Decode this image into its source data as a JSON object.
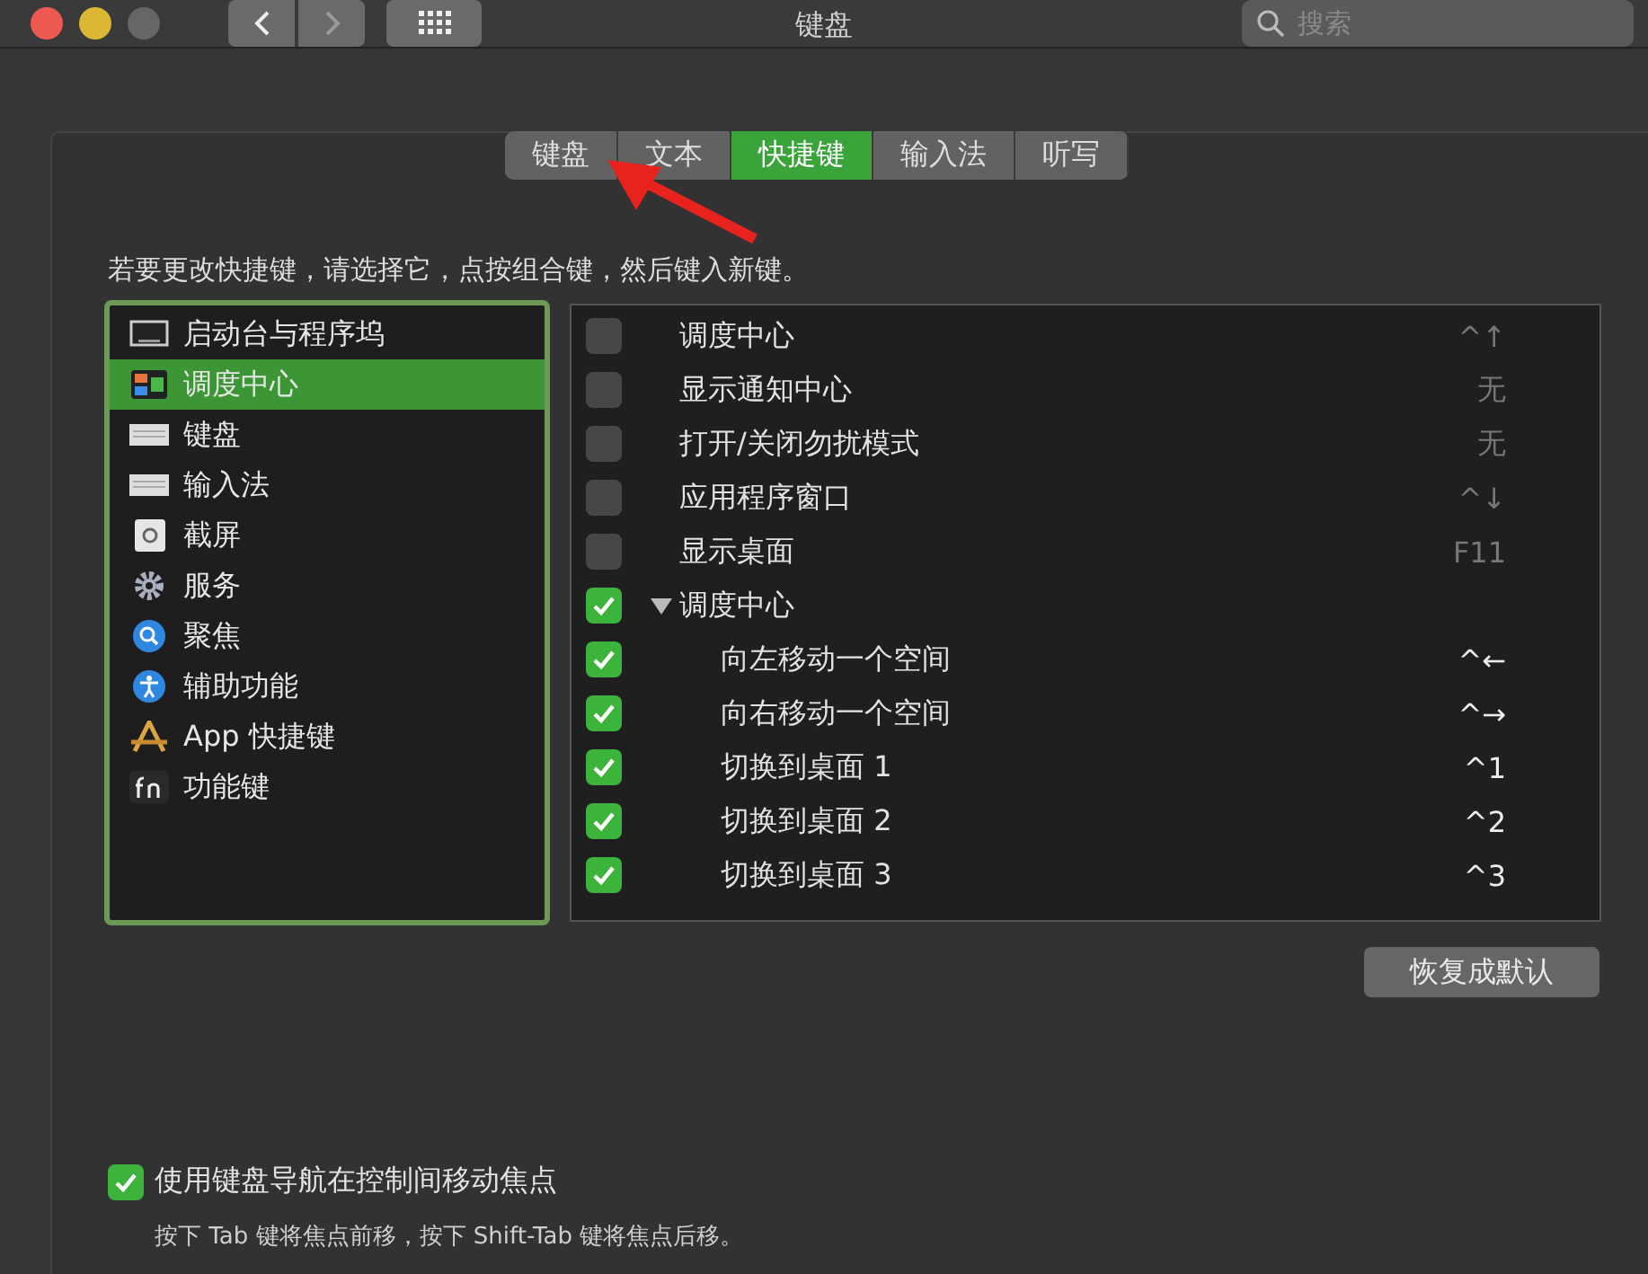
{
  "window": {
    "title": "键盘",
    "search": {
      "placeholder": "搜索"
    }
  },
  "tabs": [
    {
      "label": "键盘",
      "selected": false
    },
    {
      "label": "文本",
      "selected": false
    },
    {
      "label": "快捷键",
      "selected": true
    },
    {
      "label": "输入法",
      "selected": false
    },
    {
      "label": "听写",
      "selected": false
    }
  ],
  "instruction": "若要更改快捷键，请选择它，点按组合键，然后键入新键。",
  "categories": [
    {
      "label": "启动台与程序坞",
      "kind": "display",
      "selected": false
    },
    {
      "label": "调度中心",
      "kind": "mission",
      "selected": true
    },
    {
      "label": "键盘",
      "kind": "keyboard",
      "selected": false
    },
    {
      "label": "输入法",
      "kind": "keyboard",
      "selected": false
    },
    {
      "label": "截屏",
      "kind": "screenshot",
      "selected": false
    },
    {
      "label": "服务",
      "kind": "gear",
      "selected": false
    },
    {
      "label": "聚焦",
      "kind": "search",
      "selected": false
    },
    {
      "label": "辅助功能",
      "kind": "accessibility",
      "selected": false
    },
    {
      "label": "App 快捷键",
      "kind": "appstore",
      "selected": false
    },
    {
      "label": "功能键",
      "kind": "fn",
      "selected": false
    }
  ],
  "shortcuts": [
    {
      "label": "调度中心",
      "shortcut": "^↑",
      "checked": false
    },
    {
      "label": "显示通知中心",
      "shortcut": "无",
      "checked": false
    },
    {
      "label": "打开/关闭勿扰模式",
      "shortcut": "无",
      "checked": false
    },
    {
      "label": "应用程序窗口",
      "shortcut": "^↓",
      "checked": false
    },
    {
      "label": "显示桌面",
      "shortcut": "F11",
      "checked": false
    },
    {
      "label": "调度中心",
      "checked": true,
      "expanded": true,
      "children": [
        {
          "label": "向左移动一个空间",
          "shortcut": "^←",
          "checked": true
        },
        {
          "label": "向右移动一个空间",
          "shortcut": "^→",
          "checked": true
        },
        {
          "label": "切换到桌面 1",
          "shortcut": "^1",
          "checked": true
        },
        {
          "label": "切换到桌面 2",
          "shortcut": "^2",
          "checked": true
        },
        {
          "label": "切换到桌面 3",
          "shortcut": "^3",
          "checked": true
        }
      ]
    }
  ],
  "restore_button": "恢复成默认",
  "keyboard_navigation": {
    "label": "使用键盘导航在控制间移动焦点",
    "checked": true,
    "hint": "按下 Tab 键将焦点前移，按下 Shift-Tab 键将焦点后移。"
  }
}
